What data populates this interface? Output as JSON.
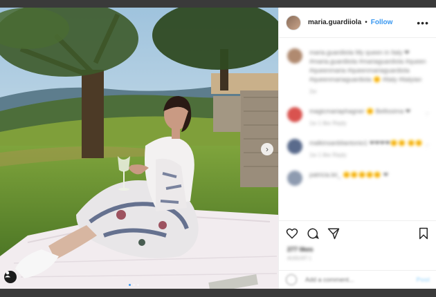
{
  "post": {
    "username": "maria.guardiiola",
    "separator": "•",
    "follow_label": "Follow",
    "more_icon": "more-horizontal-icon",
    "next_icon": "chevron-right-icon",
    "photo_indicator_count": 3,
    "active_photo_index": 0
  },
  "comments": [
    {
      "username": "maria.guardiiola",
      "text": "My queen in Italy ❤ #maria.guardiiola #mariaguardiola #queen #queenmaria #queenmariaguardiola #queenmariaguardiola 🌞 #italy #italyian",
      "meta": "2w",
      "avatar_color": "#b08a70"
    },
    {
      "username": "magicmariaphagner",
      "text": "🌞 Bellissima ❤",
      "meta": "1w  1 like  Reply",
      "avatar_color": "#d9534f"
    },
    {
      "username": "malkinsanbliantonio1",
      "text": "❤❤❤❤🌞🌞 🌞🌞",
      "meta": "1w  1 like  Reply",
      "avatar_color": "#5a6b8c"
    },
    {
      "username": "patricia.lei_",
      "text": "🌞🌞🌞🌞🌞 ❤",
      "meta": "",
      "avatar_color": "#8e9bb0"
    }
  ],
  "footer": {
    "likes": "277 likes",
    "posted": "AUGUST 1",
    "comment_placeholder": "Add a comment...",
    "post_label": "Post"
  },
  "colors": {
    "accent": "#3897f0",
    "active_dot": "#3897f0"
  }
}
